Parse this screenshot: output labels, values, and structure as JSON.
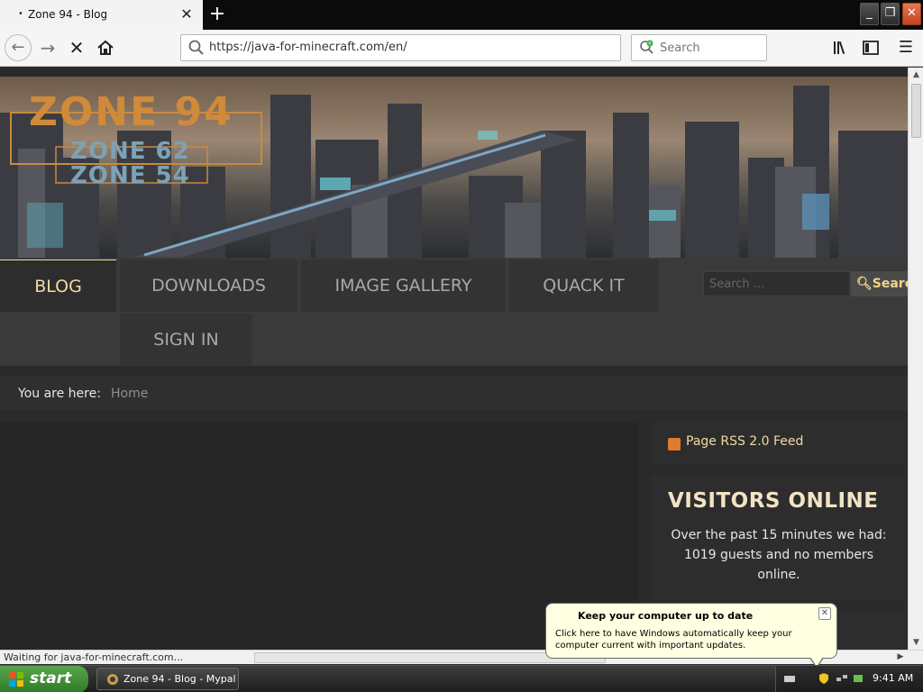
{
  "browser": {
    "tab_title": "Zone 94 - Blog",
    "url": "https://java-for-minecraft.com/en/",
    "search_placeholder": "Search",
    "status_text": "Waiting for java-for-minecraft.com..."
  },
  "site": {
    "logo_main": "ZONE 94",
    "logo_sub1": "ZONE 62",
    "logo_sub2": "ZONE 54",
    "menu": {
      "blog": "BLOG",
      "downloads": "DOWNLOADS",
      "gallery": "IMAGE GALLERY",
      "quack": "QUACK IT",
      "signin": "SIGN IN"
    },
    "search": {
      "placeholder": "Search ...",
      "button": "Search"
    },
    "breadcrumb": {
      "label": "You are here:",
      "current": "Home"
    },
    "rss_label": "Page RSS 2.0 Feed",
    "visitors": {
      "heading": "VISITORS ONLINE",
      "text": "Over the past 15 minutes we had: 1019 guests and no members online."
    }
  },
  "balloon": {
    "title": "Keep your computer up to date",
    "body": "Click here to have Windows automatically keep your computer current with important updates."
  },
  "taskbar": {
    "start_label": "start",
    "window_button": "Zone 94 - Blog - Mypal",
    "clock": "9:41 AM"
  },
  "colors": {
    "menu_active": "#f3d9a3",
    "accent_orange": "#d08a3a",
    "rss_orange": "#e07b2e",
    "start_green": "#3e8f33"
  }
}
